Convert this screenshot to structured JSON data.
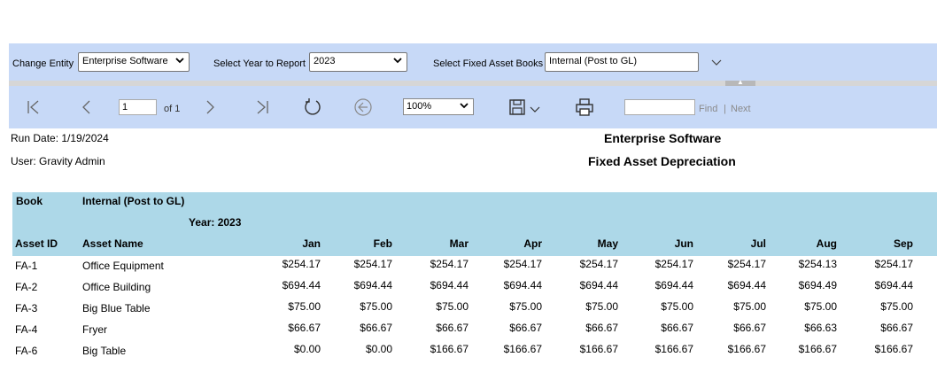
{
  "filters": {
    "entity_label": "Change Entity",
    "entity_value": "Enterprise Software",
    "year_label": "Select Year to Report",
    "year_value": "2023",
    "books_label": "Select Fixed Asset Books",
    "books_value": "Internal (Post to GL)"
  },
  "toolbar": {
    "page_value": "1",
    "page_of": "of 1",
    "zoom": "100%",
    "find_placeholder": "",
    "find_label": "Find",
    "separator": "|",
    "next_label": "Next"
  },
  "report": {
    "run_date": "Run Date: 1/19/2024",
    "user": "User: Gravity Admin",
    "entity_title": "Enterprise Software",
    "report_title": "Fixed Asset Depreciation",
    "book_label": "Book",
    "book_value": "Internal (Post to GL)",
    "year_label": "Year: 2023",
    "col_asset_id": "Asset ID",
    "col_asset_name": "Asset Name",
    "months": [
      "Jan",
      "Feb",
      "Mar",
      "Apr",
      "May",
      "Jun",
      "Jul",
      "Aug",
      "Sep"
    ],
    "rows": [
      {
        "id": "FA-1",
        "name": "Office Equipment",
        "values": [
          "$254.17",
          "$254.17",
          "$254.17",
          "$254.17",
          "$254.17",
          "$254.17",
          "$254.17",
          "$254.13",
          "$254.17"
        ]
      },
      {
        "id": "FA-2",
        "name": "Office Building",
        "values": [
          "$694.44",
          "$694.44",
          "$694.44",
          "$694.44",
          "$694.44",
          "$694.44",
          "$694.44",
          "$694.49",
          "$694.44"
        ]
      },
      {
        "id": "FA-3",
        "name": "Big Blue Table",
        "values": [
          "$75.00",
          "$75.00",
          "$75.00",
          "$75.00",
          "$75.00",
          "$75.00",
          "$75.00",
          "$75.00",
          "$75.00"
        ]
      },
      {
        "id": "FA-4",
        "name": "Fryer",
        "values": [
          "$66.67",
          "$66.67",
          "$66.67",
          "$66.67",
          "$66.67",
          "$66.67",
          "$66.67",
          "$66.63",
          "$66.67"
        ]
      },
      {
        "id": "FA-6",
        "name": "Big Table",
        "values": [
          "$0.00",
          "$0.00",
          "$166.67",
          "$166.67",
          "$166.67",
          "$166.67",
          "$166.67",
          "$166.67",
          "$166.67"
        ]
      }
    ]
  }
}
